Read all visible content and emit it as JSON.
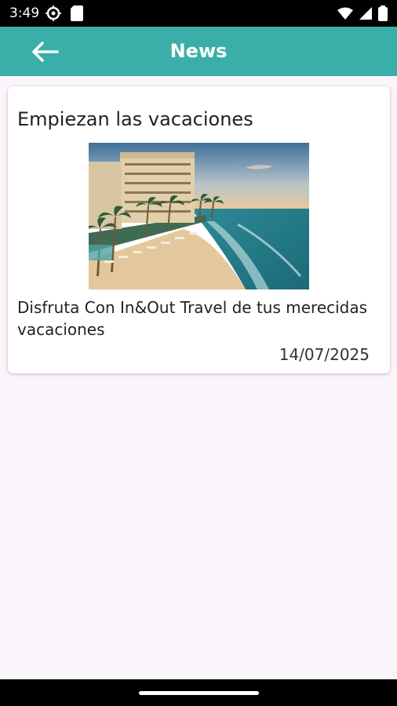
{
  "status": {
    "time": "3:49"
  },
  "app_bar": {
    "title": "News"
  },
  "news": [
    {
      "title": "Empiezan las vacaciones",
      "description": "Disfruta Con In&Out Travel de tus merecidas vacaciones",
      "date": "14/07/2025"
    }
  ],
  "colors": {
    "app_bar": "#3aafa9",
    "background": "#fbf5fb",
    "card": "#ffffff"
  }
}
